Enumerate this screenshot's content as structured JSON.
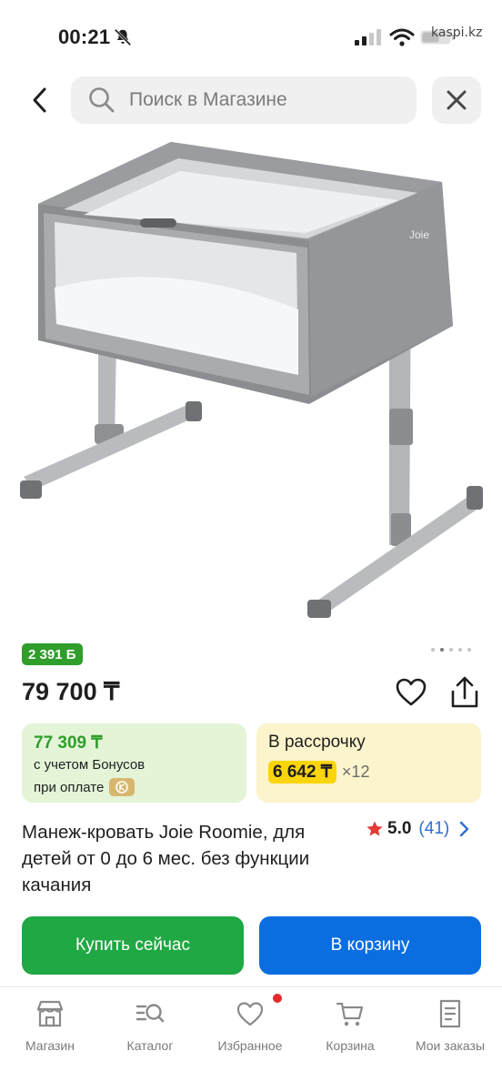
{
  "status_bar": {
    "time": "00:21",
    "domain": "kaspi.kz"
  },
  "header": {
    "search_placeholder": "Поиск в Магазине"
  },
  "product": {
    "bonus_badge": "2 391 Б",
    "image_dots": {
      "count": 5,
      "active_index": 1
    },
    "price": "79 700 ₸",
    "bonus_card": {
      "price": "77 309 ₸",
      "line1": "с учетом Бонусов",
      "line2": "при оплате"
    },
    "installment_card": {
      "title": "В рассрочку",
      "amount": "6 642 ₸",
      "multiplier": "×12"
    },
    "title": "Манеж-кровать Joie Roomie, для детей от 0 до 6 мес. без функции качания",
    "rating": {
      "score": "5.0",
      "count": "(41)"
    }
  },
  "actions": {
    "buy_now": "Купить сейчас",
    "to_cart": "В корзину"
  },
  "bottom_nav": {
    "items": [
      {
        "label": "Магазин",
        "icon": "shop-icon"
      },
      {
        "label": "Каталог",
        "icon": "catalog-icon"
      },
      {
        "label": "Избранное",
        "icon": "heart-icon"
      },
      {
        "label": "Корзина",
        "icon": "cart-icon"
      },
      {
        "label": "Мои заказы",
        "icon": "orders-icon"
      }
    ]
  },
  "colors": {
    "bonus_green": "#2f9e2b",
    "buy_green": "#1fa843",
    "cart_blue": "#0a6ee0",
    "installment_yellow": "#fbd50c",
    "rating_star": "#e53935",
    "link_blue": "#2f6fd1"
  }
}
